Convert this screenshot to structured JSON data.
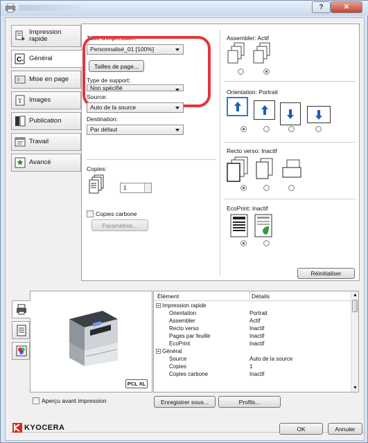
{
  "window": {
    "help_label": "?",
    "close_label": "✕"
  },
  "tabs": [
    {
      "label": "Impression rapide",
      "icon": "quick-print-icon"
    },
    {
      "label": "Général",
      "icon": "general-icon"
    },
    {
      "label": "Mise en page",
      "icon": "layout-icon"
    },
    {
      "label": "Images",
      "icon": "images-icon"
    },
    {
      "label": "Publication",
      "icon": "publication-icon"
    },
    {
      "label": "Travail",
      "icon": "job-icon"
    },
    {
      "label": "Avancé",
      "icon": "advanced-icon"
    }
  ],
  "general": {
    "print_size_label": "Taille d'impression:",
    "print_size_value": "Personnalisé_01 [100%]",
    "page_sizes_button": "Tailles de page...",
    "media_type_label": "Type de support:",
    "media_type_value": "Non spécifié",
    "source_label": "Source:",
    "source_value": "Auto de la source",
    "destination_label": "Destination:",
    "destination_value": "Par défaut",
    "copies_label": "Copies:",
    "copies_value": "1",
    "carbon_copies_label": "Copies carbone",
    "parameters_button": "Paramètres...",
    "collate_label": "Assembler: Actif",
    "orientation_label": "Orientation: Portrait",
    "duplex_label": "Recto verso: Inactif",
    "ecoprint_label": "EcoPrint: Inactif",
    "reset_button": "Réinitialiser"
  },
  "summary": {
    "col_element": "Élément",
    "col_details": "Détails",
    "rows": [
      {
        "group": true,
        "element": "Impression rapide",
        "details": ""
      },
      {
        "group": false,
        "element": "Orientation",
        "details": "Portrait"
      },
      {
        "group": false,
        "element": "Assembler",
        "details": "Actif"
      },
      {
        "group": false,
        "element": "Recto verso",
        "details": "Inactif"
      },
      {
        "group": false,
        "element": "Pages par feuille",
        "details": "Inactif"
      },
      {
        "group": false,
        "element": "EcoPrint",
        "details": "Inactif"
      },
      {
        "group": true,
        "element": "Général",
        "details": ""
      },
      {
        "group": false,
        "element": "Source",
        "details": "Auto de la source"
      },
      {
        "group": false,
        "element": "Copies",
        "details": "1"
      },
      {
        "group": false,
        "element": "Copies carbone",
        "details": "Inactif"
      }
    ]
  },
  "preview": {
    "pcl_badge": "PCL XL"
  },
  "bottom": {
    "preview_checkbox_label": "Aperçu avant impression",
    "save_as_button": "Enregistrer sous...",
    "profiles_button": "Profils..."
  },
  "footer": {
    "brand": "KYOCERA",
    "ok_button": "OK",
    "cancel_button": "Annuler"
  },
  "colors": {
    "highlight_ring": "#e3353e",
    "brand_red": "#e2231a",
    "selected_blue": "#3a77c7"
  }
}
